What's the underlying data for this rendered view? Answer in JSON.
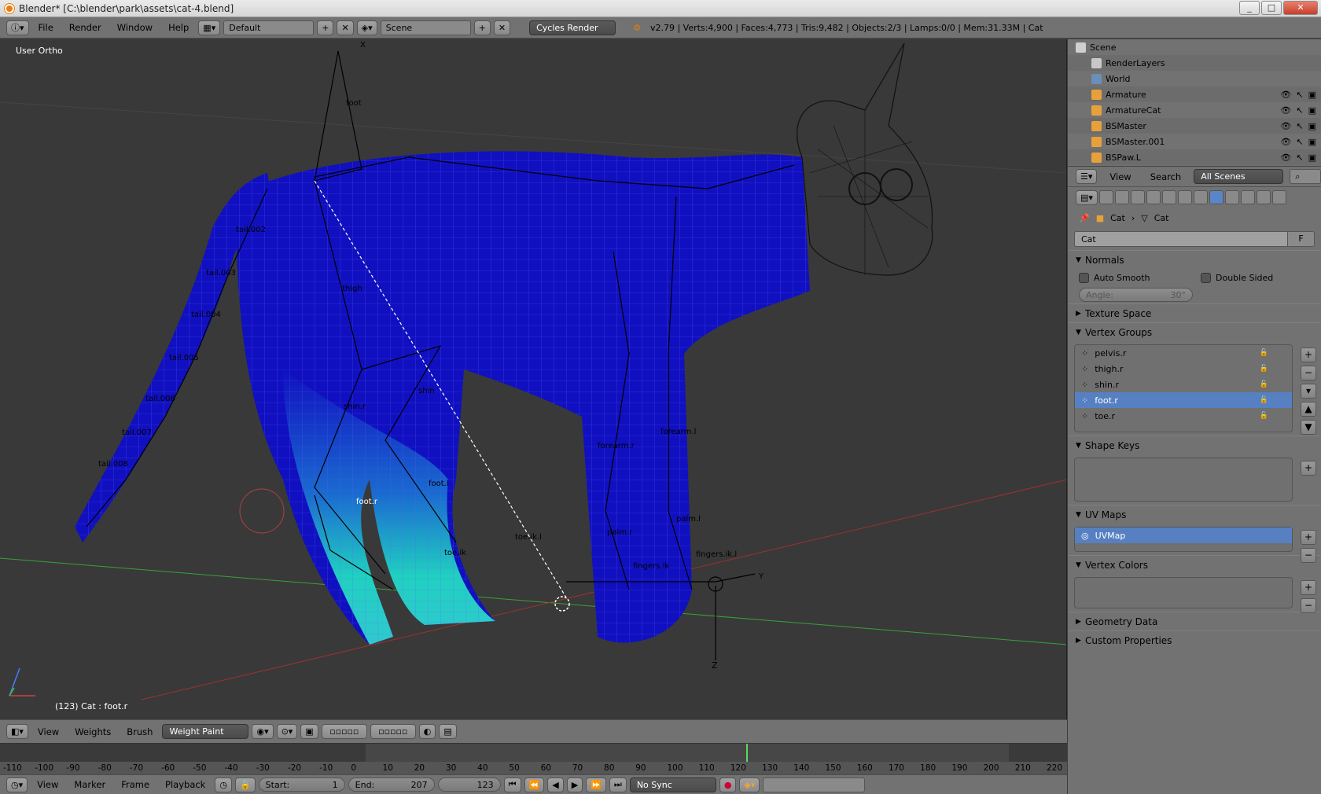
{
  "window": {
    "title": "Blender* [C:\\blender\\park\\assets\\cat-4.blend]",
    "btn_min": "_",
    "btn_max": "□",
    "btn_close": "✕"
  },
  "infobar": {
    "menus": [
      "File",
      "Render",
      "Window",
      "Help"
    ],
    "layout": "Default",
    "scene": "Scene",
    "engine": "Cycles Render",
    "stats": "v2.79 | Verts:4,900 | Faces:4,773 | Tris:9,482 | Objects:2/3 | Lamps:0/0 | Mem:31.33M | Cat"
  },
  "viewport": {
    "label": "User Ortho",
    "status": "(123) Cat : foot.r",
    "bone_labels": [
      "foot",
      "tail.002",
      "tail.003",
      "tail.004",
      "tail.005",
      "tail.006",
      "tail.007",
      "tail.008",
      "thigh",
      "shin",
      "shin.r",
      "foot.r",
      "foot.l",
      "toe.ik.l",
      "toe.ik",
      "forearm.r",
      "forearm.l",
      "palm.l",
      "palm.r",
      "fingers.ik.l",
      "fingers.ik"
    ],
    "axis_x": "X",
    "axis_y": "Y",
    "axis_z": "Z"
  },
  "view3d_header": {
    "menus": [
      "View",
      "Weights",
      "Brush"
    ],
    "mode": "Weight Paint"
  },
  "timeline": {
    "ticks": [
      "-110",
      "-100",
      "-90",
      "-80",
      "-70",
      "-60",
      "-50",
      "-40",
      "-30",
      "-20",
      "-10",
      "0",
      "10",
      "20",
      "30",
      "40",
      "50",
      "60",
      "70",
      "80",
      "90",
      "100",
      "110",
      "120",
      "130",
      "140",
      "150",
      "160",
      "170",
      "180",
      "190",
      "200",
      "210",
      "220"
    ],
    "current_frame_value": 123,
    "menus": [
      "View",
      "Marker",
      "Frame",
      "Playback"
    ],
    "start_label": "Start:",
    "start_value": "1",
    "end_label": "End:",
    "end_value": "207",
    "current": "123",
    "sync": "No Sync"
  },
  "outliner": {
    "rows": [
      {
        "name": "Scene",
        "icon": "scene-icon",
        "color": "#d0d0d0"
      },
      {
        "name": "RenderLayers",
        "icon": "renderlayers-icon",
        "color": "#c8c8c8"
      },
      {
        "name": "World",
        "icon": "world-icon",
        "color": "#6a8fb8"
      },
      {
        "name": "Armature",
        "icon": "armature-icon",
        "color": "#e8a13a"
      },
      {
        "name": "ArmatureCat",
        "icon": "armature-icon",
        "color": "#e8a13a"
      },
      {
        "name": "BSMaster",
        "icon": "mesh-icon",
        "color": "#e8a13a"
      },
      {
        "name": "BSMaster.001",
        "icon": "mesh-icon",
        "color": "#e8a13a"
      },
      {
        "name": "BSPaw.L",
        "icon": "mesh-icon",
        "color": "#e8a13a"
      }
    ],
    "header_view": "View",
    "header_search": "Search",
    "header_filter": "All Scenes"
  },
  "properties": {
    "crumb_object": "Cat",
    "crumb_data": "Cat",
    "mesh_name": "Cat",
    "fake_user": "F",
    "normals": {
      "title": "Normals",
      "auto_smooth": "Auto Smooth",
      "double_sided": "Double Sided",
      "angle_label": "Angle:",
      "angle_value": "30°"
    },
    "texture_space": "Texture Space",
    "vertex_groups": {
      "title": "Vertex Groups",
      "items": [
        "pelvis.r",
        "thigh.r",
        "shin.r",
        "foot.r",
        "toe.r"
      ],
      "selected": 3
    },
    "shape_keys": "Shape Keys",
    "uv_maps": {
      "title": "UV Maps",
      "items": [
        "UVMap"
      ]
    },
    "vertex_colors": "Vertex Colors",
    "geometry_data": "Geometry Data",
    "custom_properties": "Custom Properties"
  },
  "colors": {
    "mesh_blue": "#1010c0",
    "weight_cyan": "#20d0c0",
    "selection": "#5680c2",
    "grid_green": "#3aa03a",
    "grid_red": "#a03030"
  }
}
